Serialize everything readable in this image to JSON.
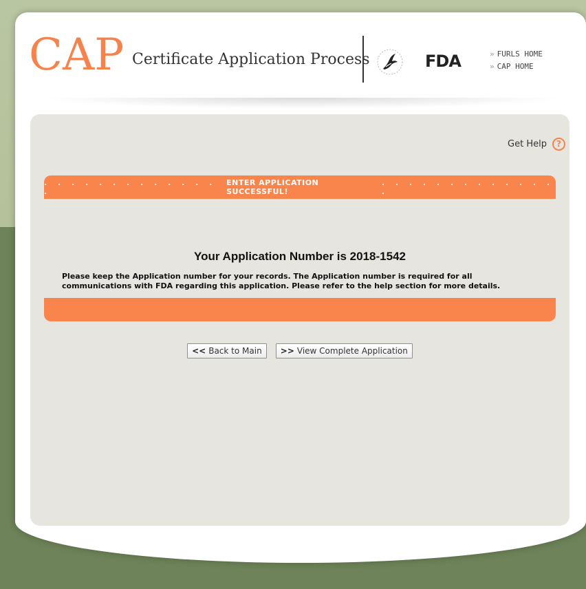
{
  "header": {
    "logo_text": "CAP",
    "title": "Certificate Application Process",
    "agency_logo_text": "FDA",
    "links": [
      {
        "label": "FURLS HOME"
      },
      {
        "label": "CAP HOME"
      }
    ]
  },
  "help": {
    "label": "Get Help",
    "icon_glyph": "?"
  },
  "banner": {
    "dots_left": ". . . . . . . . . . . . . .",
    "text": "ENTER APPLICATION SUCCESSFUL!",
    "dots_right": ". . . . . . . . . . . . . ."
  },
  "result": {
    "heading": "Your Application Number is 2018-1542",
    "note": "Please keep the Application number for your records. The Application number is required for all communications with FDA regarding this application. Please refer to the help section for more details."
  },
  "buttons": {
    "back_icon": "<<",
    "back_label": "Back to Main",
    "view_icon": ">>",
    "view_label": "View Complete Application"
  },
  "colors": {
    "accent_orange": "#f9844c",
    "panel_bg": "#e6e5e0",
    "bg_green_light": "#b4c19a",
    "bg_green_dark": "#6e8359"
  },
  "icons": [
    "hhs-eagle-icon",
    "help-question-icon",
    "chevron-double-left-icon",
    "chevron-double-right-icon"
  ]
}
